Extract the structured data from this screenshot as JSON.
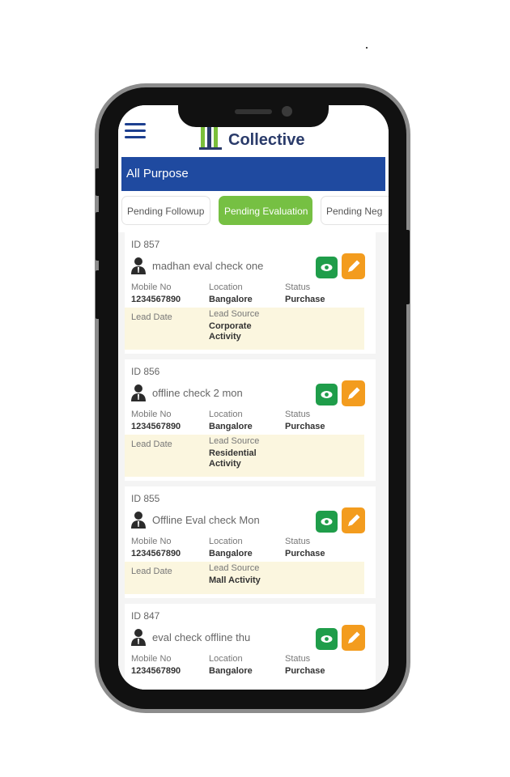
{
  "app": {
    "logo_text": "Collective",
    "page_title": "All Purpose"
  },
  "tabs": [
    {
      "label": "Pending Followup"
    },
    {
      "label": "Pending Evaluation"
    },
    {
      "label": "Pending Neg"
    }
  ],
  "field_labels": {
    "mobile": "Mobile No",
    "location": "Location",
    "status": "Status",
    "lead_date": "Lead Date",
    "lead_source": "Lead Source"
  },
  "leads": [
    {
      "id": "ID 857",
      "name": "madhan eval check one",
      "mobile": "1234567890",
      "location": "Bangalore",
      "status": "Purchase",
      "lead_date": "",
      "lead_source": "Corporate Activity"
    },
    {
      "id": "ID 856",
      "name": "offline check 2 mon",
      "mobile": "1234567890",
      "location": "Bangalore",
      "status": "Purchase",
      "lead_date": "",
      "lead_source": "Residential Activity"
    },
    {
      "id": "ID 855",
      "name": "Offline Eval check Mon",
      "mobile": "1234567890",
      "location": "Bangalore",
      "status": "Purchase",
      "lead_date": "",
      "lead_source": "Mall Activity"
    },
    {
      "id": "ID 847",
      "name": "eval check offline thu",
      "mobile": "1234567890",
      "location": "Bangalore",
      "status": "Purchase"
    }
  ],
  "colors": {
    "primary": "#1f4aa0",
    "active_tab": "#76c043",
    "view_button": "#1f9d4a",
    "edit_button": "#f39c1e",
    "lead_band": "#fbf6df"
  }
}
